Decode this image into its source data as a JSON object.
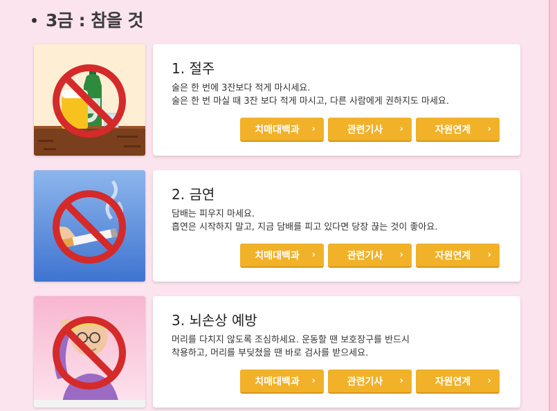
{
  "section": {
    "title": "3금 : 참을 것"
  },
  "items": [
    {
      "title": "1. 절주",
      "lines": [
        "술은 한 번에 3잔보다 적게 마시세요.",
        "술은 한 번 마실 때 3잔 보다 적게 마시고, 다른 사람에게 권하지도 마세요."
      ],
      "image_icon": "no-drinking-icon"
    },
    {
      "title": "2. 금연",
      "lines": [
        "담배는 피우지 마세요.",
        "흡연은 시작하지 말고, 지금 담배를 피고 있다면 당장 끊는 것이 좋아요."
      ],
      "image_icon": "no-smoking-icon"
    },
    {
      "title": "3. 뇌손상 예방",
      "lines": [
        "머리를 다치지 않도록 조심하세요. 운동할 땐 보호장구를 반드시",
        "착용하고, 머리를 부딪쳤을 땐 바로 검사를 받으세요."
      ],
      "image_icon": "no-head-injury-icon"
    }
  ],
  "buttons": {
    "encyclopedia": "치매대백과",
    "articles": "관련기사",
    "resources": "자원연계",
    "chevron": "›"
  },
  "colors": {
    "background": "#fce4ee",
    "button": "#f1b129",
    "prohibition": "#d42a2a"
  }
}
